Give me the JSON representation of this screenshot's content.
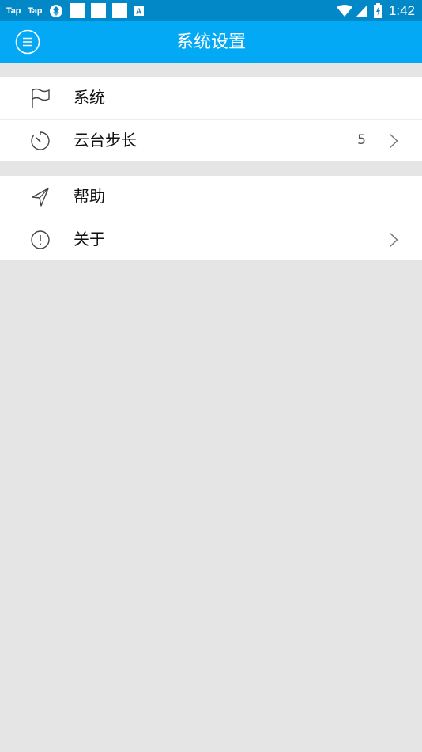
{
  "status_bar": {
    "left_labels": [
      "Tap",
      "Tap"
    ],
    "badge_letter": "A",
    "time": "1:42",
    "icons": [
      "tap-app-icon",
      "tap-app-icon",
      "sync-icon",
      "blank-notification",
      "blank-notification",
      "blank-notification",
      "a-notification",
      "wifi-icon",
      "cell-signal-icon",
      "battery-charging-icon"
    ]
  },
  "app_bar": {
    "title": "系统设置",
    "menu_icon": "menu-circle-icon",
    "background": "#03a9f4"
  },
  "colors": {
    "status_bar": "#0288c6",
    "page_background": "#e5e5e5",
    "row_background": "#ffffff"
  },
  "settings": {
    "groups": [
      {
        "items": [
          {
            "label": "系统",
            "icon": "flag-icon",
            "value": "",
            "chevron": false
          },
          {
            "label": "云台步长",
            "icon": "timer-icon",
            "value": "5",
            "chevron": true
          }
        ]
      },
      {
        "items": [
          {
            "label": "帮助",
            "icon": "send-arrow-icon",
            "value": "",
            "chevron": false
          },
          {
            "label": "关于",
            "icon": "info-exclamation-icon",
            "value": "",
            "chevron": true
          }
        ]
      }
    ]
  }
}
